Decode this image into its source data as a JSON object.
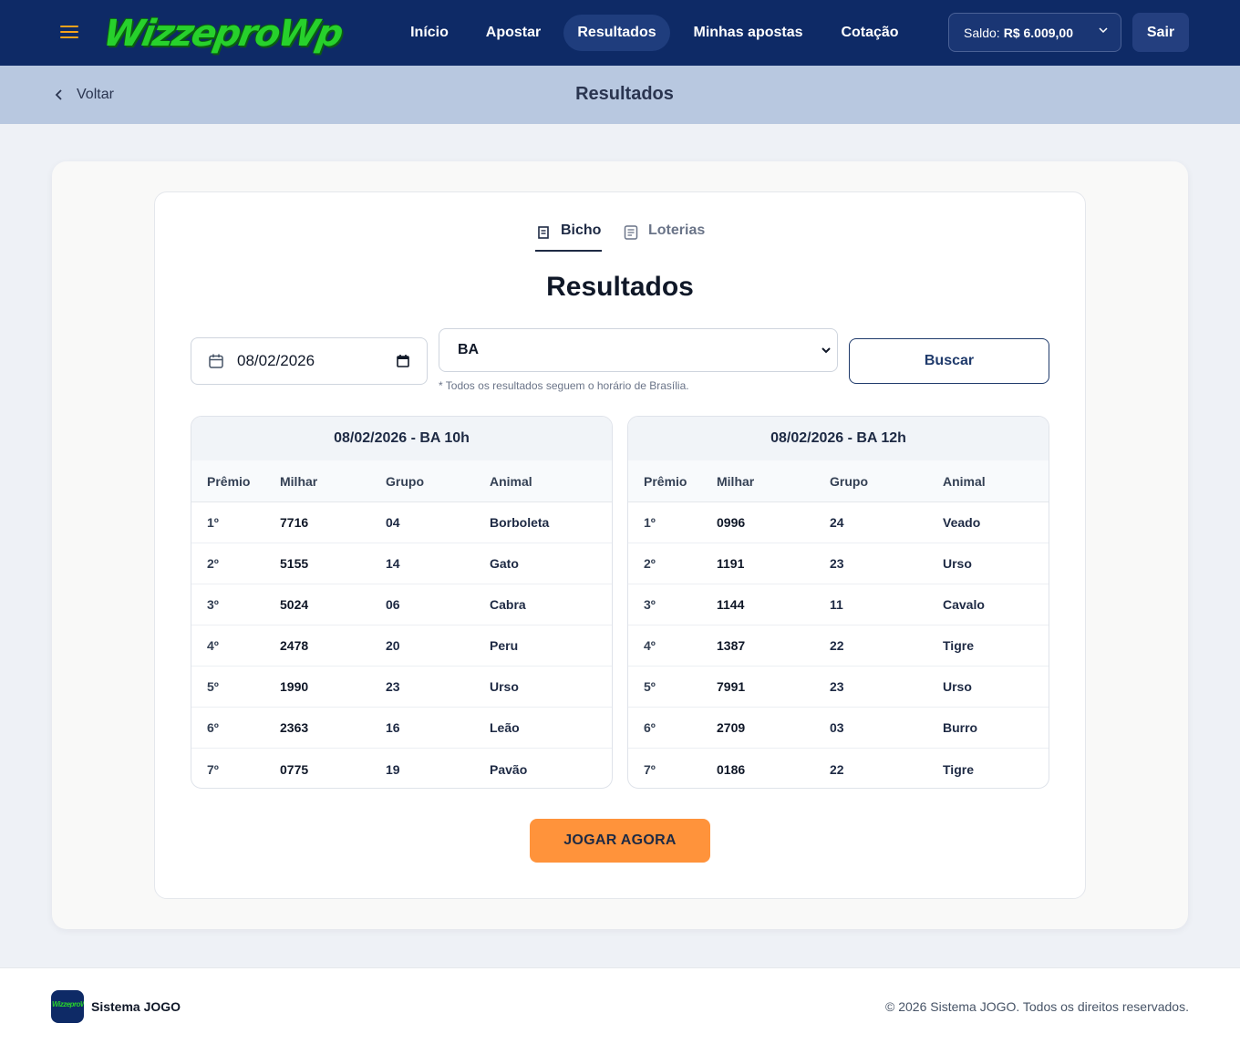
{
  "header": {
    "logo_text": "WizzeproWp",
    "nav": [
      {
        "label": "Início"
      },
      {
        "label": "Apostar"
      },
      {
        "label": "Resultados"
      },
      {
        "label": "Minhas apostas"
      },
      {
        "label": "Cotação"
      }
    ],
    "saldo_label": "Saldo:",
    "saldo_value": "R$ 6.009,00",
    "logout_label": "Sair",
    "accent_color": "#f6a21b",
    "background_color": "#0e2a66"
  },
  "subheader": {
    "back_label": "Voltar",
    "title": "Resultados"
  },
  "tabs": [
    {
      "label": "Bicho",
      "icon": "receipt-icon",
      "active": true
    },
    {
      "label": "Loterias",
      "icon": "document-icon",
      "active": false
    }
  ],
  "page_heading": "Resultados",
  "filters": {
    "date_value": "08/02/2026",
    "state_value": "BA",
    "hint": "* Todos os resultados seguem o horário de Brasília.",
    "search_label": "Buscar"
  },
  "columns": [
    "Prêmio",
    "Milhar",
    "Grupo",
    "Animal"
  ],
  "results": [
    {
      "title": "08/02/2026 - BA 10h",
      "rows": [
        [
          "1º",
          "7716",
          "04",
          "Borboleta"
        ],
        [
          "2º",
          "5155",
          "14",
          "Gato"
        ],
        [
          "3º",
          "5024",
          "06",
          "Cabra"
        ],
        [
          "4º",
          "2478",
          "20",
          "Peru"
        ],
        [
          "5º",
          "1990",
          "23",
          "Urso"
        ],
        [
          "6º",
          "2363",
          "16",
          "Leão"
        ],
        [
          "7º",
          "0775",
          "19",
          "Pavão"
        ]
      ]
    },
    {
      "title": "08/02/2026 - BA 12h",
      "rows": [
        [
          "1º",
          "0996",
          "24",
          "Veado"
        ],
        [
          "2º",
          "1191",
          "23",
          "Urso"
        ],
        [
          "3º",
          "1144",
          "11",
          "Cavalo"
        ],
        [
          "4º",
          "1387",
          "22",
          "Tigre"
        ],
        [
          "5º",
          "7991",
          "23",
          "Urso"
        ],
        [
          "6º",
          "2709",
          "03",
          "Burro"
        ],
        [
          "7º",
          "0186",
          "22",
          "Tigre"
        ]
      ]
    }
  ],
  "cta_label": "JOGAR AGORA",
  "cta_color": "#ff933b",
  "footer": {
    "logo_text": "WizzeproWp",
    "brand": "Sistema JOGO",
    "copyright": "© 2026 Sistema JOGO. Todos os direitos reservados."
  }
}
